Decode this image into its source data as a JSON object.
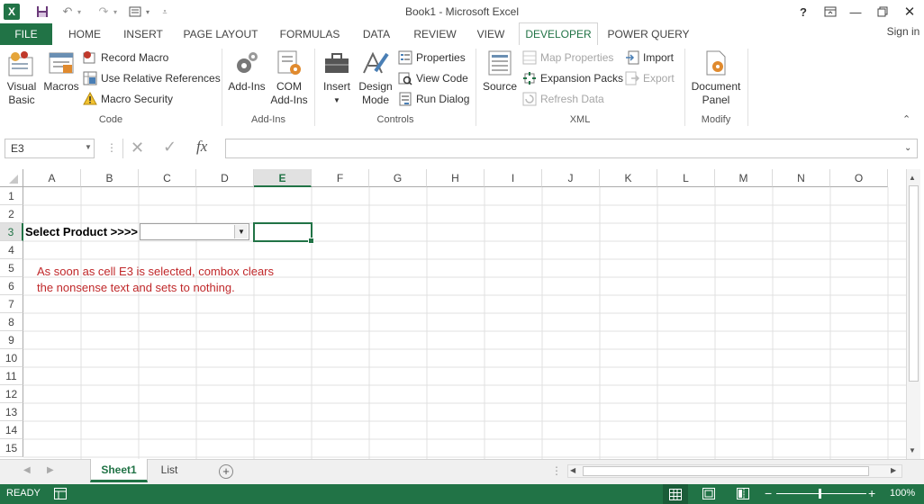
{
  "app": {
    "title": "Book1 - Microsoft Excel",
    "sign_in": "Sign in",
    "help": "?"
  },
  "colors": {
    "accent": "#217346",
    "annotation_red": "#c0282a"
  },
  "tabs": [
    "FILE",
    "HOME",
    "INSERT",
    "PAGE LAYOUT",
    "FORMULAS",
    "DATA",
    "REVIEW",
    "VIEW",
    "DEVELOPER",
    "POWER QUERY"
  ],
  "active_tab": "DEVELOPER",
  "ribbon": {
    "code": {
      "label": "Code",
      "visual_basic": [
        "Visual",
        "Basic"
      ],
      "macros": "Macros",
      "record_macro": "Record Macro",
      "use_relative": "Use Relative References",
      "macro_security": "Macro Security"
    },
    "addins": {
      "label": "Add-Ins",
      "add_ins": "Add-Ins",
      "com_add_ins": [
        "COM",
        "Add-Ins"
      ]
    },
    "controls": {
      "label": "Controls",
      "insert": "Insert",
      "design_mode": [
        "Design",
        "Mode"
      ],
      "properties": "Properties",
      "view_code": "View Code",
      "run_dialog": "Run Dialog"
    },
    "xml": {
      "label": "XML",
      "source": "Source",
      "map_properties": "Map Properties",
      "expansion_packs": "Expansion Packs",
      "refresh_data": "Refresh Data",
      "import": "Import",
      "export": "Export"
    },
    "modify": {
      "label": "Modify",
      "document_panel": [
        "Document",
        "Panel"
      ]
    }
  },
  "formula_bar": {
    "name_box": "E3",
    "fx": "fx",
    "value": ""
  },
  "grid": {
    "columns": [
      "A",
      "B",
      "C",
      "D",
      "E",
      "F",
      "G",
      "H",
      "I",
      "J",
      "K",
      "L",
      "M",
      "N",
      "O"
    ],
    "rows": [
      "1",
      "2",
      "3",
      "4",
      "5",
      "6",
      "7",
      "8",
      "9",
      "10",
      "11",
      "12",
      "13",
      "14",
      "15"
    ],
    "selected_col": "E",
    "selected_row": "3",
    "cells": {
      "A3": "Select Product >>>>",
      "annotation_line1": "As soon as cell E3 is selected, combox clears",
      "annotation_line2": "the nonsense text and sets to nothing."
    },
    "combobox_value": ""
  },
  "sheets": [
    "Sheet1",
    "List"
  ],
  "active_sheet": "Sheet1",
  "status": {
    "ready": "READY",
    "zoom": "100%"
  }
}
